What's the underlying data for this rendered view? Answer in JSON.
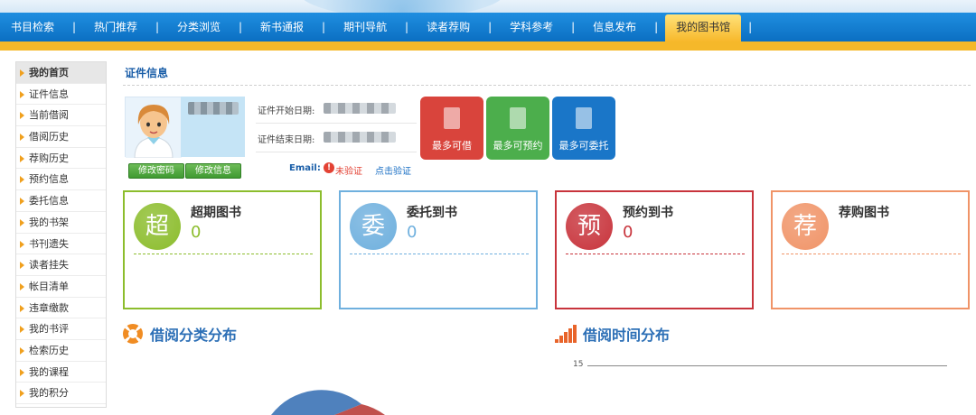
{
  "nav": {
    "items": [
      "书目检索",
      "热门推荐",
      "分类浏览",
      "新书通报",
      "期刊导航",
      "读者荐购",
      "学科参考",
      "信息发布",
      "我的图书馆"
    ],
    "active_index": 8,
    "separator": "|"
  },
  "sidebar": {
    "items": [
      "我的首页",
      "证件信息",
      "当前借阅",
      "借阅历史",
      "荐购历史",
      "预约信息",
      "委托信息",
      "我的书架",
      "书刊遗失",
      "读者挂失",
      "帐目清单",
      "违章缴款",
      "我的书评",
      "检索历史",
      "我的课程",
      "我的积分"
    ],
    "selected_index": 0
  },
  "main": {
    "section_title": "证件信息",
    "profile": {
      "change_password_label": "修改密码",
      "edit_info_label": "修改信息"
    },
    "card_info": {
      "start_label": "证件开始日期:",
      "end_label": "证件结束日期:",
      "email_label": "Email:",
      "unverified_text": "未验证",
      "verify_link": "点击验证"
    },
    "tiles": [
      {
        "label": "最多可借",
        "color": "#d9443c"
      },
      {
        "label": "最多可预约",
        "color": "#4cae4c"
      },
      {
        "label": "最多可委托",
        "color": "#1a76c8"
      }
    ],
    "stat_cards": [
      {
        "glyph": "超",
        "title": "超期图书",
        "value": "0",
        "color": "#8cbd2d"
      },
      {
        "glyph": "委",
        "title": "委托到书",
        "value": "0",
        "color": "#6fb0de"
      },
      {
        "glyph": "预",
        "title": "预约到书",
        "value": "0",
        "color": "#c8343c"
      },
      {
        "glyph": "荐",
        "title": "荐购图书",
        "value": "",
        "color": "#f09468"
      }
    ],
    "charts": {
      "category_title": "借阅分类分布",
      "time_title": "借阅时间分布",
      "time_axis_tick": "15"
    }
  }
}
